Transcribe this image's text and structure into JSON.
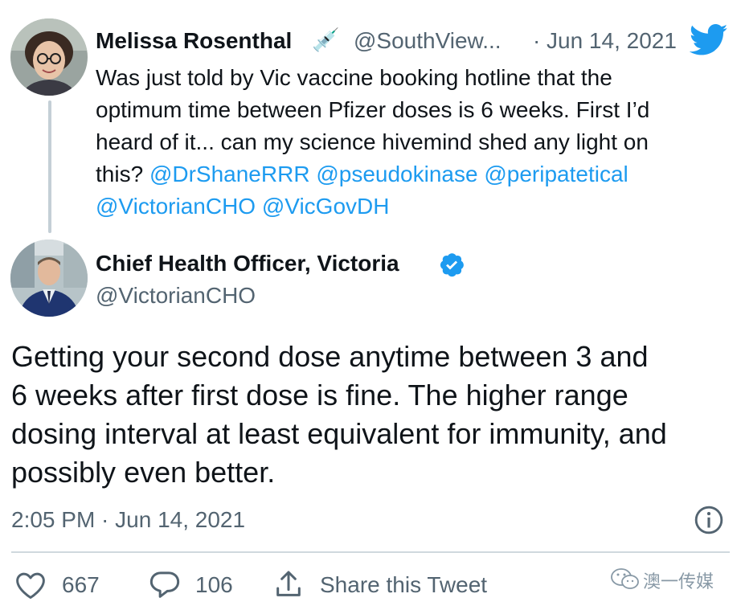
{
  "quoted_tweet": {
    "author_name": "Melissa Rosenthal",
    "name_emoji": "💉",
    "handle": "@SouthView...",
    "separator": "·",
    "date": "Jun 14, 2021",
    "text_line_1": "Was just told by Vic vaccine booking hotline that the",
    "text_line_2": "optimum time between Pfizer  doses is 6 weeks. First I’d",
    "text_line_3": "heard of it... can my science hivemind shed any light on",
    "text_line_4_prefix": "this? ",
    "mentions": [
      "@DrShaneRRR",
      "@pseudokinase",
      "@peripatetical",
      "@VictorianCHO",
      "@VicGovDH"
    ]
  },
  "main_tweet": {
    "author_name": "Chief Health Officer, Victoria",
    "verified_icon": "verified-badge-icon",
    "handle": "@VictorianCHO",
    "text_line_1": "Getting your second dose anytime between 3 and",
    "text_line_2": "6 weeks after first dose is fine. The higher range",
    "text_line_3": "dosing interval at least equivalent for immunity, and",
    "text_line_4": "possibly even better.",
    "timestamp": "2:05 PM · Jun 14, 2021"
  },
  "actions": {
    "like_count": "667",
    "reply_count": "106",
    "share_label": "Share this Tweet"
  },
  "watermark": {
    "text": "澳一传媒"
  },
  "colors": {
    "twitter_blue": "#1d9bf0",
    "text_primary": "#0f1419",
    "text_secondary": "#536471"
  },
  "icons": [
    "twitter-bird-icon",
    "verified-badge-icon",
    "info-icon",
    "heart-icon",
    "reply-bubble-icon",
    "share-icon",
    "wechat-icon"
  ]
}
